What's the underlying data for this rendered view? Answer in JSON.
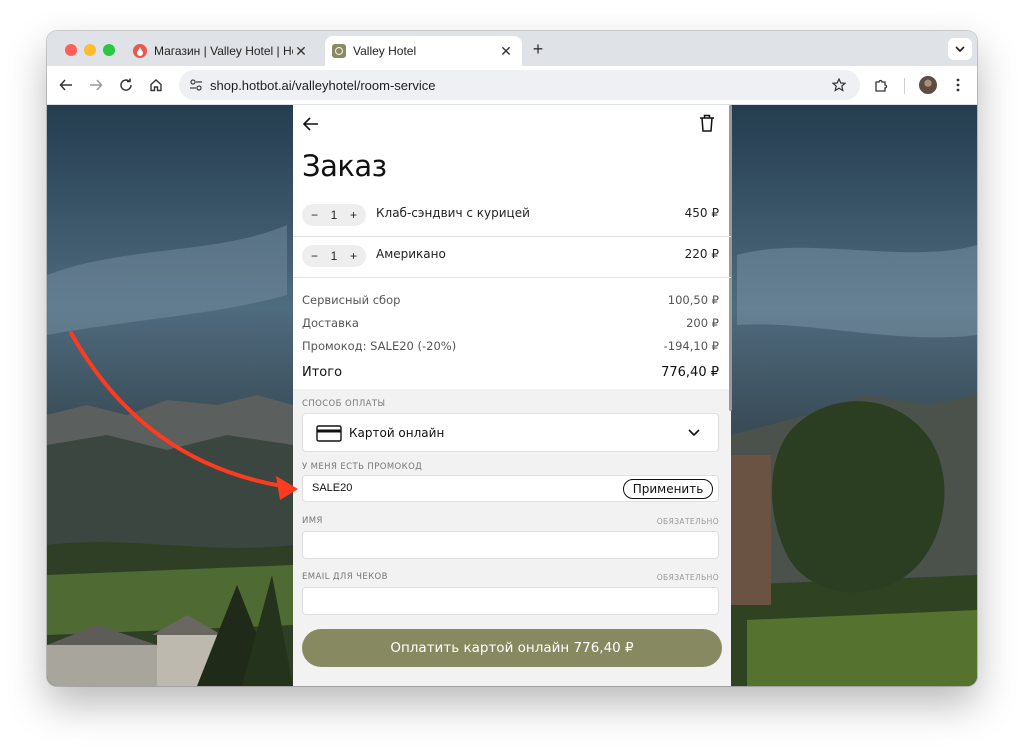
{
  "browser": {
    "tabs": [
      {
        "title": "Магазин | Valley Hotel | Hotbot",
        "active": false,
        "favicon": "hotbot-favicon"
      },
      {
        "title": "Valley Hotel",
        "active": true,
        "favicon": "valley-hotel-favicon"
      }
    ],
    "url": "shop.hotbot.ai/valleyhotel/room-service",
    "colors": {
      "close": "#ff5f57",
      "minimize": "#febc2e",
      "maximize": "#28c840"
    }
  },
  "page": {
    "title": "Заказ",
    "items": [
      {
        "name": "Клаб-сэндвич с курицей",
        "quantity": "1",
        "price": "450 ₽",
        "minus": "−",
        "plus": "+"
      },
      {
        "name": "Американо",
        "quantity": "1",
        "price": "220 ₽",
        "minus": "−",
        "plus": "+"
      }
    ],
    "summary": [
      {
        "label": "Сервисный сбор",
        "value": "100,50 ₽"
      },
      {
        "label": "Доставка",
        "value": "200 ₽"
      },
      {
        "label": "Промокод: SALE20 (-20%)",
        "value": "-194,10 ₽"
      }
    ],
    "total": {
      "label": "Итого",
      "value": "776,40 ₽"
    },
    "payment": {
      "section_label": "СПОСОБ ОПЛАТЫ",
      "selected": "Картой онлайн"
    },
    "promo": {
      "section_label": "У МЕНЯ ЕСТЬ ПРОМОКОД",
      "value": "SALE20",
      "apply_label": "Применить"
    },
    "name_field": {
      "label": "ИМЯ",
      "required": "ОБЯЗАТЕЛЬНО",
      "value": ""
    },
    "email_field": {
      "label": "EMAIL ДЛЯ ЧЕКОВ",
      "required": "ОБЯЗАТЕЛЬНО",
      "value": ""
    },
    "pay_button": "Оплатить картой онлайн 776,40 ₽",
    "colors": {
      "accent": "#878a60",
      "annotation_arrow": "#ff3b1f"
    }
  }
}
